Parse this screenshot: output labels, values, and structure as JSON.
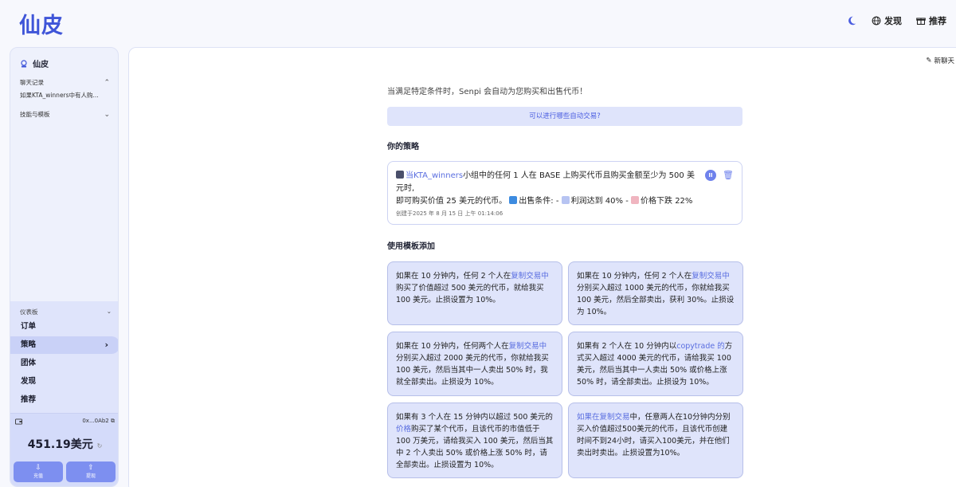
{
  "header": {
    "logo": "仙皮",
    "discover": "发现",
    "recommend": "推荐"
  },
  "sidebar": {
    "title": "仙皮",
    "chat_history_label": "聊天记录",
    "chat_history_item": "如果KTA_winners中有人购...",
    "skills_label": "技能与模板",
    "menu_head": "仪表板",
    "menu": [
      "订单",
      "策略",
      "团体",
      "发现",
      "推荐"
    ],
    "wallet_address": "0x...0Ab2",
    "wallet_balance": "451.19美元",
    "deposit_label": "充值",
    "withdraw_label": "提现"
  },
  "main": {
    "new_chat": "新聊天",
    "intro": "当满足特定条件时，Senpi 会自动为您购买和出售代币！",
    "suggest_button": "可以进行哪些自动交易?",
    "strategy_heading": "你的策略",
    "strategy": {
      "prefix": "当",
      "group": "KTA_winners",
      "line1": "小组中的任何 1 人在 BASE 上购买代币且购买金额至少为 500 美元时,",
      "line2a": "即可购买价值 25 美元的代币。",
      "sell_label": "出售条件: -",
      "profit": "利润达到 40% -",
      "drop": "价格下跌 22%",
      "created": "创建于2025 年 8 月 15 日 上午 01:14:06"
    },
    "templates_heading": "使用模板添加",
    "templates": [
      {
        "pre": "如果在 10 分钟内，任何 2 个人在",
        "link": "复制交易中",
        "post": "购买了价值超过 500 美元的代币，就给我买 100 美元。止损设置为 10%。"
      },
      {
        "pre": "如果在 10 分钟内，任何 2 个人在",
        "link": "复制交易中",
        "post": "分别买入超过 1000 美元的代币，你就给我买 100 美元，然后全部卖出，获利 30%。止损设为 10%。"
      },
      {
        "pre": "如果在 10 分钟内，任何两个人在",
        "link": "复制交易中",
        "post": "分别买入超过 2000 美元的代币，你就给我买 100 美元，然后当其中一人卖出 50% 时，我就全部卖出。止损设为 10%。"
      },
      {
        "pre": "如果有 2 个人在 10 分钟内以",
        "link": "copytrade 的",
        "post": "方式买入超过 4000 美元的代币，请给我买 100 美元，然后当其中一人卖出 50% 或价格上涨 50% 时，请全部卖出。止损设为 10%。"
      },
      {
        "pre": "如果有 3 个人在 15 分钟内以超过 500 美元的",
        "link": "价格",
        "post": "购买了某个代币，且该代币的市值低于 100 万美元，请给我买入 100 美元，然后当其中 2 个人卖出 50% 或价格上涨 50% 时，请全部卖出。止损设置为 10%。"
      },
      {
        "pre": "",
        "link": "如果在复制交易",
        "post": "中，任意两人在10分钟内分别买入价值超过500美元的代币，且该代币创建时间不到24小时，请买入100美元，并在他们卖出时卖出。止损设置为10%。"
      }
    ]
  }
}
